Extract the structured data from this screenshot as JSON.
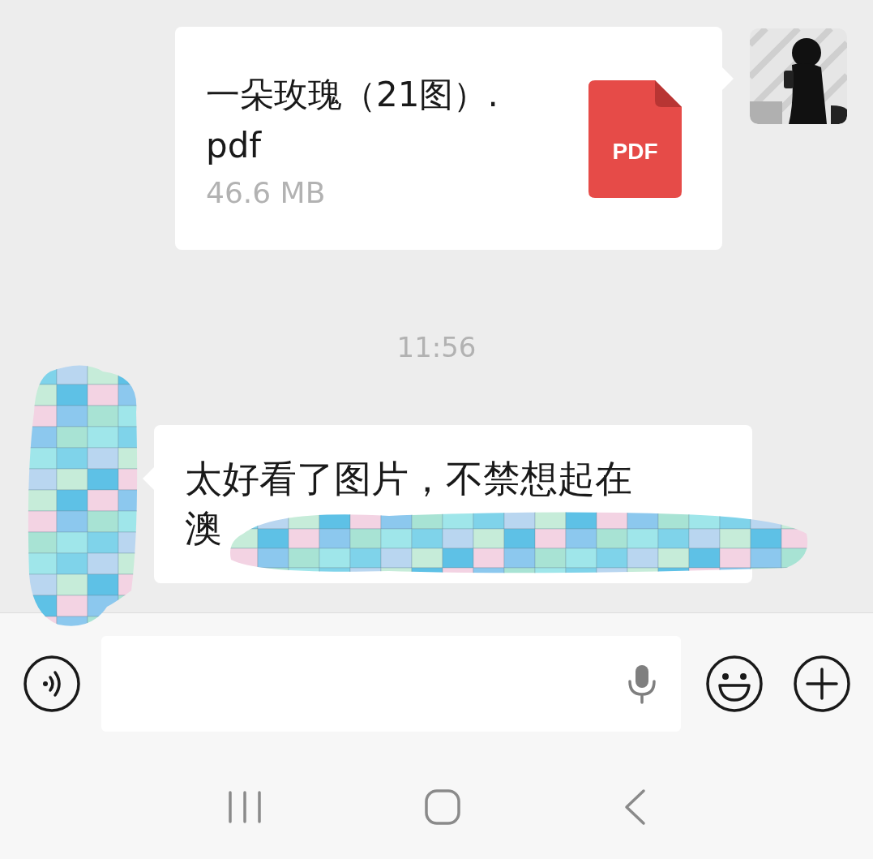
{
  "messages": [
    {
      "kind": "file",
      "file_name": "一朵玫瑰（21图）.pdf",
      "file_size": "46.6 MB",
      "file_type": "PDF"
    },
    {
      "kind": "time",
      "text": "11:56"
    },
    {
      "kind": "text",
      "lines": [
        "太好看了图片，不禁想起在",
        "澳"
      ],
      "redacted": true
    }
  ]
}
